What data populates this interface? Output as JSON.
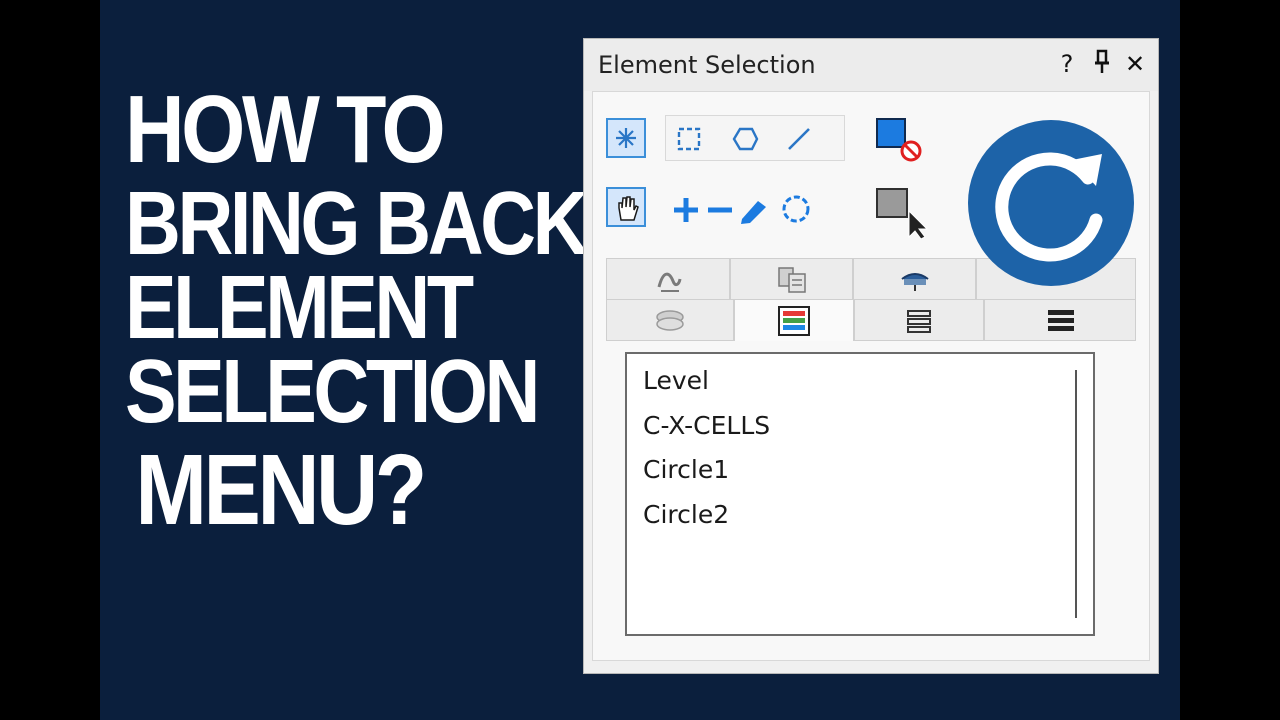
{
  "headline": {
    "line1": "HOW TO",
    "line2": "BRING BACK",
    "line3": "ELEMENT",
    "line4": "SELECTION",
    "line5": "MENU?"
  },
  "dialog": {
    "title": "Element Selection",
    "help_glyph": "?",
    "pin_glyph": "pin",
    "close_glyph": "✕"
  },
  "list": {
    "items": [
      "Level",
      "C-X-CELLS",
      "Circle1",
      "Circle2"
    ]
  },
  "colors": {
    "background": "#0b1f3d",
    "accent": "#1d63a8",
    "tool_active": "#3b8fd9"
  },
  "icons": [
    "snowflake-select-icon",
    "rectangle-select-icon",
    "shape-select-icon",
    "line-select-icon",
    "hand-select-icon",
    "add-icon",
    "subtract-icon",
    "pencil-icon",
    "circle-select-icon",
    "clear-selection-icon",
    "selection-cursor-icon",
    "refresh-icon"
  ]
}
